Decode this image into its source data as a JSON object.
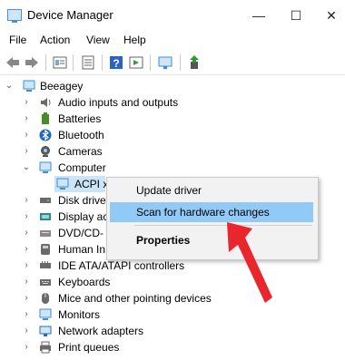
{
  "window": {
    "title": "Device Manager",
    "buttons": [
      "—",
      "☐",
      "✕"
    ]
  },
  "menu": [
    "File",
    "Action",
    "View",
    "Help"
  ],
  "toolbar": {
    "icons": [
      "back-arrow-icon",
      "forward-arrow-icon",
      "properties-sheet-icon",
      "list-view-icon",
      "help-question-icon",
      "action-icon",
      "scan-monitor-icon",
      "update-driver-icon"
    ]
  },
  "tree": {
    "root": "Beeagey",
    "items": [
      {
        "label": "Audio inputs and outputs",
        "icon": "speaker-icon",
        "color": "#6a6a6a"
      },
      {
        "label": "Batteries",
        "icon": "battery-icon",
        "color": "#4a8a2a"
      },
      {
        "label": "Bluetooth",
        "icon": "bluetooth-icon",
        "color": "#1e63c6"
      },
      {
        "label": "Cameras",
        "icon": "camera-icon",
        "color": "#555555"
      },
      {
        "label": "Computer",
        "icon": "monitor-icon",
        "color": "#3b8fd6",
        "expanded": true,
        "children": [
          {
            "label": "ACPI x",
            "icon": "monitor-icon",
            "color": "#3b8fd6",
            "selected": true
          }
        ]
      },
      {
        "label": "Disk drive",
        "icon": "disk-icon",
        "color": "#6a6a6a"
      },
      {
        "label": "Display ac",
        "icon": "display-adapter-icon",
        "color": "#2a8a8a"
      },
      {
        "label": "DVD/CD-",
        "icon": "dvd-icon",
        "color": "#888888"
      },
      {
        "label": "Human In",
        "icon": "hid-icon",
        "color": "#6a6a6a"
      },
      {
        "label": "IDE ATA/ATAPI controllers",
        "icon": "ide-icon",
        "color": "#6a6a6a"
      },
      {
        "label": "Keyboards",
        "icon": "keyboard-icon",
        "color": "#6a6a6a"
      },
      {
        "label": "Mice and other pointing devices",
        "icon": "mouse-icon",
        "color": "#6a6a6a"
      },
      {
        "label": "Monitors",
        "icon": "monitor-icon",
        "color": "#3b8fd6"
      },
      {
        "label": "Network adapters",
        "icon": "network-icon",
        "color": "#2a6ab0"
      },
      {
        "label": "Print queues",
        "icon": "printer-icon",
        "color": "#6a6a6a"
      }
    ]
  },
  "context_menu": {
    "items": [
      {
        "label": "Update driver",
        "highlighted": false,
        "bold": false
      },
      {
        "label": "Scan for hardware changes",
        "highlighted": true,
        "bold": false
      },
      {
        "label": "Properties",
        "highlighted": false,
        "bold": true
      }
    ]
  },
  "annotation": {
    "arrow_color": "#e8262b"
  }
}
